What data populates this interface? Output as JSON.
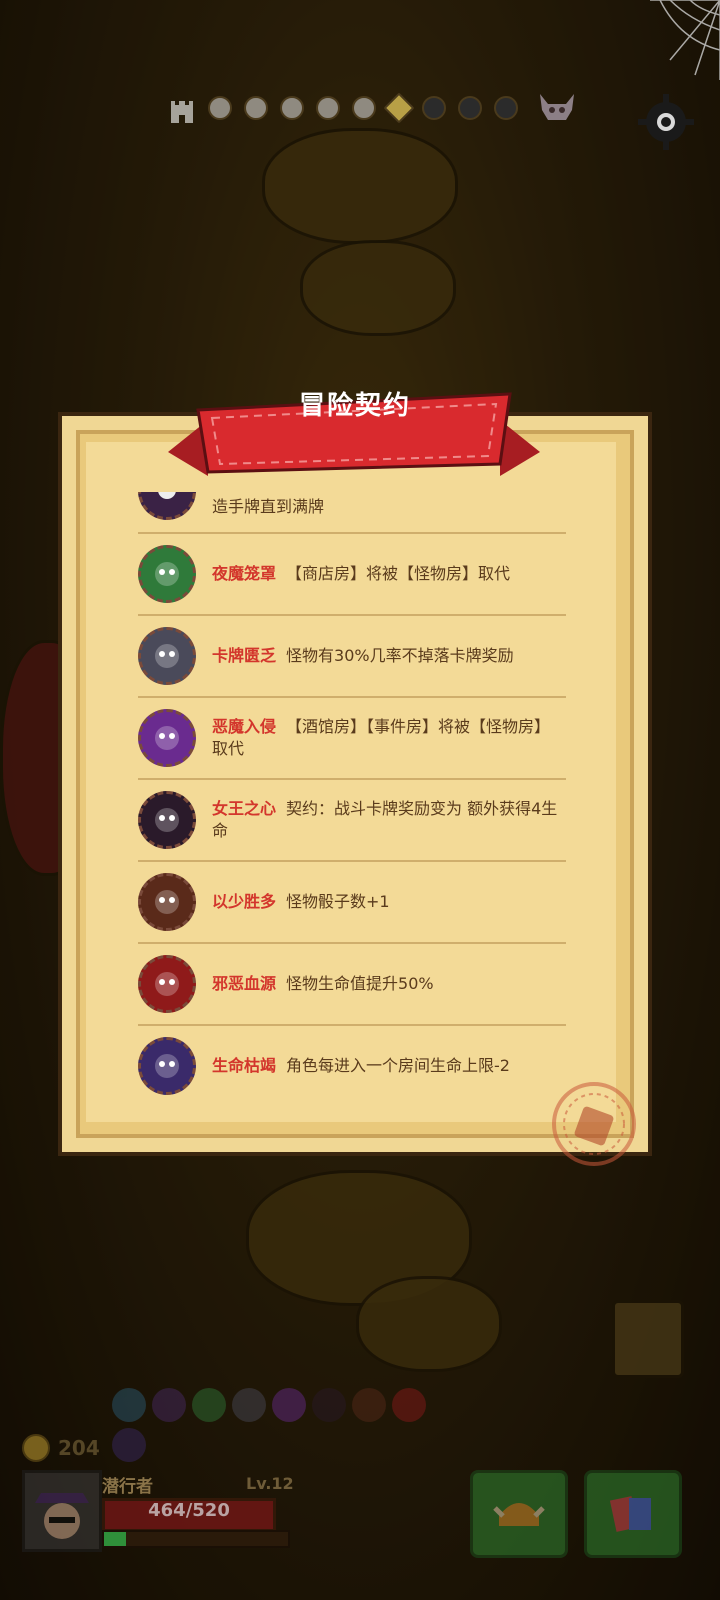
{
  "contract": {
    "title": "冒险契约",
    "partial_row": {
      "desc": "造手牌直到满牌",
      "icon": "skull-contract-icon"
    },
    "items": [
      {
        "name": "夜魔笼罩",
        "desc": "【商店房】将被【怪物房】取代",
        "icon": "green-demon-icon",
        "color": "#2f7a3a"
      },
      {
        "name": "卡牌匮乏",
        "desc": "怪物有30%几率不掉落卡牌奖励",
        "icon": "empty-card-icon",
        "color": "#4a4a5a"
      },
      {
        "name": "恶魔入侵",
        "desc": "【酒馆房】【事件房】将被【怪物房】取代",
        "icon": "purple-demon-icon",
        "color": "#6a2b8f"
      },
      {
        "name": "女王之心",
        "desc": "契约：战斗卡牌奖励变为 额外获得4生命",
        "icon": "queen-heart-icon",
        "color": "#2a1a2a"
      },
      {
        "name": "以少胜多",
        "desc": "怪物骰子数+1",
        "icon": "dice-icon",
        "color": "#5a2a1a"
      },
      {
        "name": "邪恶血源",
        "desc": "怪物生命值提升50%",
        "icon": "blood-chalice-icon",
        "color": "#8f1a1a"
      },
      {
        "name": "生命枯竭",
        "desc": "角色每进入一个房间生命上限-2",
        "icon": "candle-icon",
        "color": "#3a2a6a"
      }
    ]
  },
  "player": {
    "coins": "204",
    "name": "潜行者",
    "level": "Lv.12",
    "hp_text": "464/520",
    "hp_fraction": 0.892,
    "xp_fraction": 0.12
  },
  "map_progress": {
    "total": 10,
    "current_index": 5,
    "icons": [
      "castle-icon",
      "boss-demon-icon"
    ]
  },
  "colors": {
    "accent_red": "#d3362c",
    "parchment": "#f3da97",
    "hud_green": "#2f7e2f"
  }
}
